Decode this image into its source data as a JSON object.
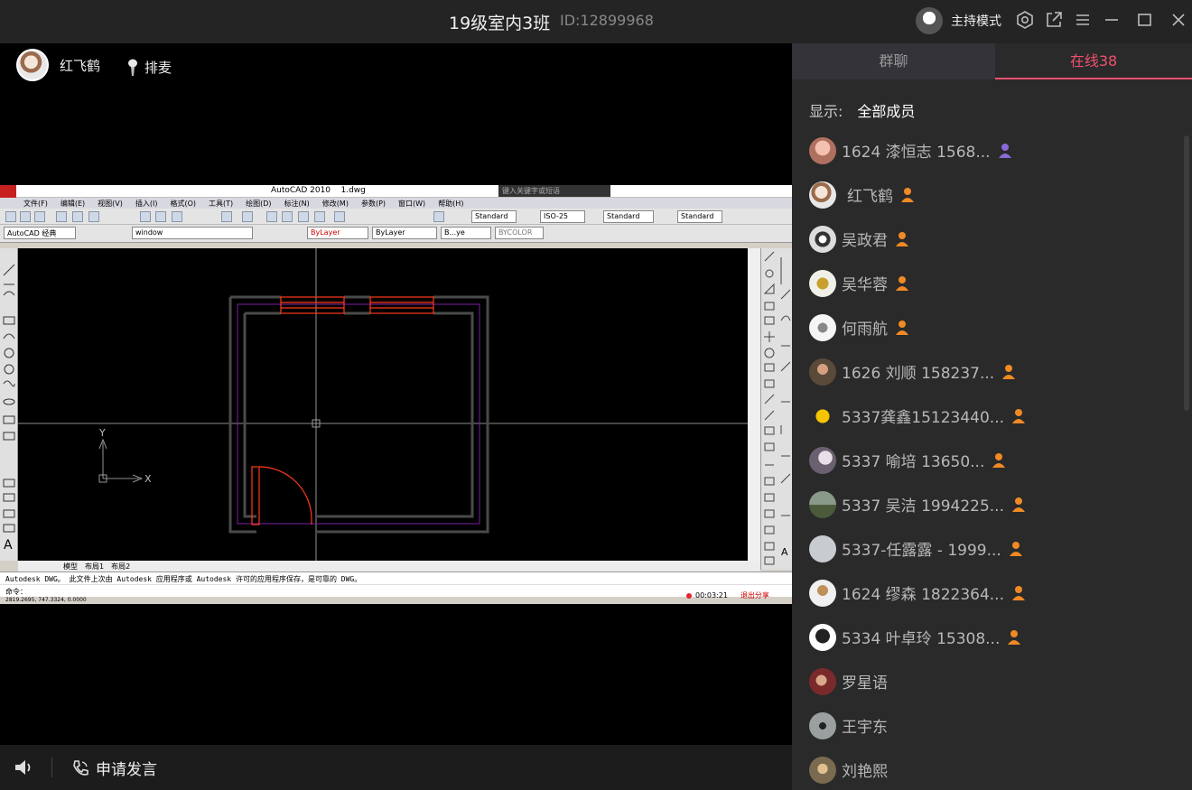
{
  "window": {
    "title": "19级室内3班",
    "room_id": "ID:12899968",
    "host_mode_label": "主持模式"
  },
  "stage": {
    "presenter_name": "红飞鹤",
    "queue_label": "排麦"
  },
  "cad": {
    "app_title": "AutoCAD 2010",
    "file_name": "1.dwg",
    "search_placeholder": "键入关键字或短语",
    "menus": [
      "文件(F)",
      "编辑(E)",
      "视图(V)",
      "插入(I)",
      "格式(O)",
      "工具(T)",
      "绘图(D)",
      "标注(N)",
      "修改(M)",
      "参数(P)",
      "窗口(W)",
      "帮助(H)"
    ],
    "text_style": "Standard",
    "dim_style": "ISO-25",
    "table_style": "Standard",
    "mleader_style": "Standard",
    "workspace": "AutoCAD 经典",
    "layer": "window",
    "color": "ByLayer",
    "linetype": "ByLayer",
    "lineweight": "B...ye",
    "plotstyle": "BYCOLOR",
    "layout_tabs": [
      "模型",
      "布局1",
      "布局2"
    ],
    "command_history": "Autodesk DWG。  此文件上次由 Autodesk 应用程序或 Autodesk 许可的应用程序保存，是可靠的 DWG。",
    "command_prompt": "命令：",
    "coords": "2819.2695, 747.3324, 0.0000",
    "axis_x": "X",
    "axis_y": "Y",
    "rec_time": "00:03:21",
    "exit_share": "退出分享"
  },
  "bottom": {
    "apply_label": "申请发言"
  },
  "panel": {
    "tab_group_chat": "群聊",
    "tab_online": "在线38",
    "filter_label": "显示:",
    "filter_value": "全部成员",
    "members": [
      {
        "name": "1624  漆恒志  1568...",
        "role": "purple"
      },
      {
        "name": "红飞鹤",
        "role": "orange"
      },
      {
        "name": "吴政君",
        "role": "orange"
      },
      {
        "name": "吴华蓉",
        "role": "orange"
      },
      {
        "name": "何雨航",
        "role": "orange"
      },
      {
        "name": "1626  刘顺  158237...",
        "role": "orange"
      },
      {
        "name": "5337龚鑫15123440...",
        "role": "orange"
      },
      {
        "name": "5337   喻培   13650...",
        "role": "orange"
      },
      {
        "name": "5337 吴洁 1994225...",
        "role": "orange"
      },
      {
        "name": "5337-任露露 - 1999...",
        "role": "orange"
      },
      {
        "name": "1624 缪森 1822364...",
        "role": "orange"
      },
      {
        "name": "5334  叶卓玲 15308...",
        "role": "orange"
      },
      {
        "name": "罗星语",
        "role": "none"
      },
      {
        "name": "王宇东",
        "role": "none"
      },
      {
        "name": "刘艳熙",
        "role": "none"
      }
    ]
  },
  "colors": {
    "accent": "#f0506e",
    "role_orange": "#f08a24",
    "role_purple": "#8a6ad6",
    "cad_red": "#ff3a1a",
    "cad_purple": "#7a1fa0"
  }
}
